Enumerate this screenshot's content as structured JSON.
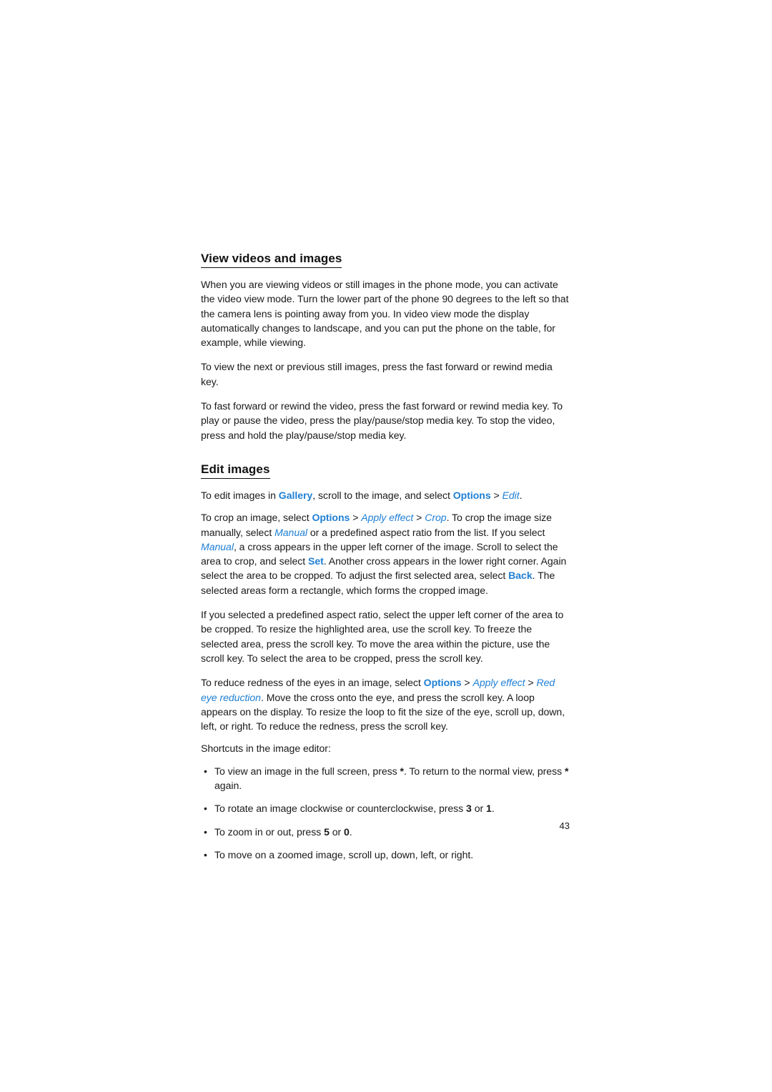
{
  "document": {
    "page_number": "43",
    "accent_color": "#2080d4",
    "text_color": "#1a1a1a"
  },
  "sections": [
    {
      "heading": "View videos and images",
      "paragraphs": [
        "When you are viewing videos or still images in the phone mode, you can activate the video view mode. Turn the lower part of the phone 90 degrees to the left so that the camera lens is pointing away from you. In video view mode the display automatically changes to landscape, and you can put the phone on the table, for example, while viewing.",
        "To view the next or previous still images, press the fast forward or rewind media key.",
        "To fast forward or rewind the video, press the fast forward or rewind media key. To play or pause the video, press the play/pause/stop media key. To stop the video, press and hold the play/pause/stop media key."
      ]
    },
    {
      "heading": "Edit images",
      "paragraphs": {
        "p1": {
          "t1": "To edit images in ",
          "ref1": "Gallery",
          "t2": ", scroll to the image, and select ",
          "ref2": "Options",
          "sep1": " > ",
          "ref3": "Edit",
          "t3": "."
        },
        "p2": {
          "t1": "To crop an image, select ",
          "ref1": "Options",
          "sep1": " > ",
          "ref2": "Apply effect",
          "sep2": " > ",
          "ref3": "Crop",
          "t2": ". To crop the image size manually, select ",
          "ref4": "Manual",
          "t3": " or a predefined aspect ratio from the list. If you select ",
          "ref5": "Manual",
          "t4": ", a cross appears in the upper left corner of the image. Scroll to select the area to crop, and select ",
          "ref6": "Set",
          "t5": ". Another cross appears in the lower right corner. Again select the area to be cropped. To adjust the first selected area, select ",
          "ref7": "Back",
          "t6": ". The selected areas form a rectangle, which forms the cropped image."
        },
        "p3": "If you selected a predefined aspect ratio, select the upper left corner of the area to be cropped. To resize the highlighted area, use the scroll key. To freeze the selected area, press the scroll key. To move the area within the picture, use the scroll key. To select the area to be cropped, press the scroll key.",
        "p4": {
          "t1": "To reduce redness of the eyes in an image, select ",
          "ref1": "Options",
          "sep1": " > ",
          "ref2": "Apply effect",
          "sep2": " > ",
          "ref3": "Red eye reduction",
          "t2": ". Move the cross onto the eye, and press the scroll key. A loop appears on the display. To resize the loop to fit the size of the eye, scroll up, down, left, or right. To reduce the redness, press the scroll key."
        },
        "p5": "Shortcuts in the image editor:"
      },
      "shortcuts": [
        {
          "t1": "To view an image in the full screen, press ",
          "key1": "*",
          "t2": ". To return to the normal view, press ",
          "key2": "*",
          "t3": " again."
        },
        {
          "t1": "To rotate an image clockwise or counterclockwise, press ",
          "key1": "3",
          "t2": " or ",
          "key2": "1",
          "t3": "."
        },
        {
          "t1": "To zoom in or out, press ",
          "key1": "5",
          "t2": " or ",
          "key2": "0",
          "t3": "."
        },
        {
          "t1": "To move on a zoomed image, scroll up, down, left, or right.",
          "key1": "",
          "t2": "",
          "key2": "",
          "t3": ""
        }
      ],
      "bullet_glyph": "•"
    }
  ]
}
